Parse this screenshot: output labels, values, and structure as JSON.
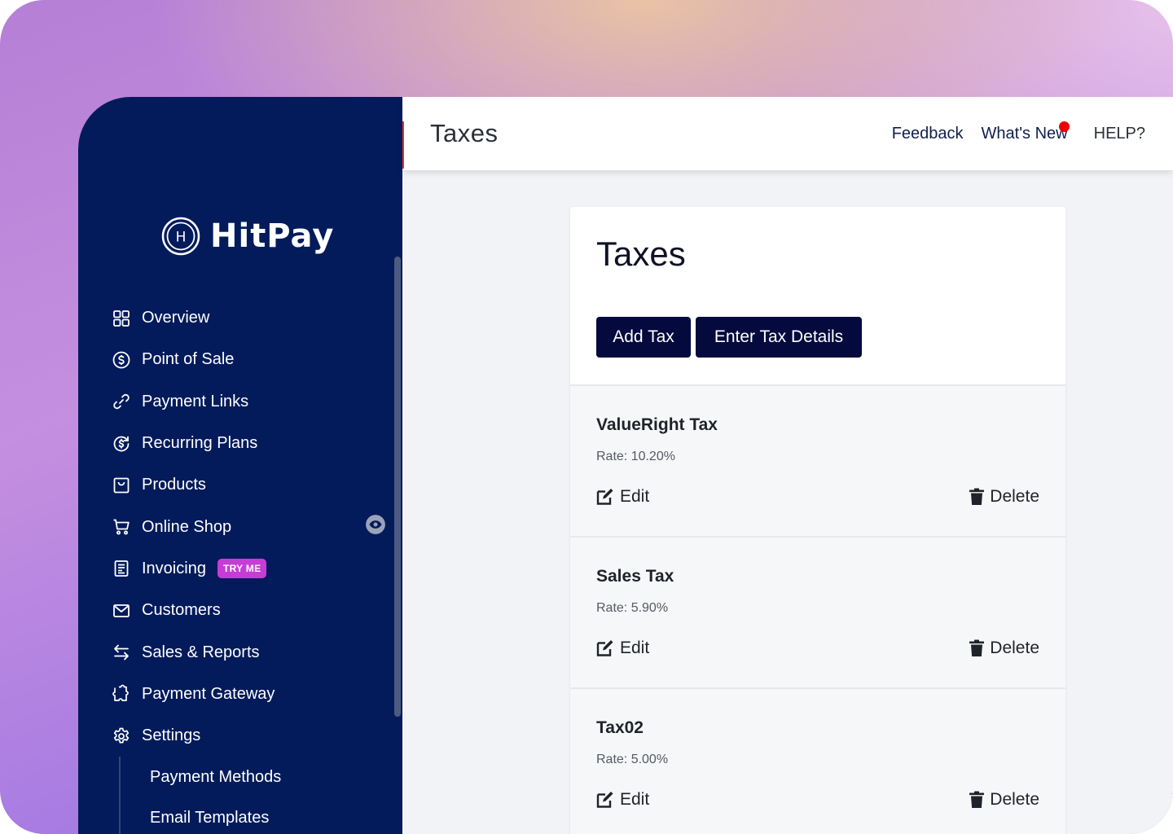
{
  "brand": {
    "name": "HitPay",
    "logo_letter": "H"
  },
  "sidebar": {
    "items": [
      {
        "label": "Overview",
        "icon": "grid-icon"
      },
      {
        "label": "Point of Sale",
        "icon": "dollar-circle-icon"
      },
      {
        "label": "Payment Links",
        "icon": "link-icon"
      },
      {
        "label": "Recurring Plans",
        "icon": "recurring-dollar-icon"
      },
      {
        "label": "Products",
        "icon": "bag-icon"
      },
      {
        "label": "Online Shop",
        "icon": "cart-icon"
      },
      {
        "label": "Invoicing",
        "icon": "invoice-icon",
        "badge": "TRY ME"
      },
      {
        "label": "Customers",
        "icon": "mail-icon"
      },
      {
        "label": "Sales & Reports",
        "icon": "swap-arrows-icon"
      },
      {
        "label": "Payment Gateway",
        "icon": "puzzle-icon"
      },
      {
        "label": "Settings",
        "icon": "gear-icon"
      }
    ],
    "sub_items": [
      {
        "label": "Payment Methods"
      },
      {
        "label": "Email Templates"
      }
    ]
  },
  "header": {
    "title": "Taxes",
    "links": {
      "feedback": "Feedback",
      "whats_new": "What's New",
      "help": "HELP?"
    }
  },
  "main": {
    "title": "Taxes",
    "buttons": {
      "add_tax": "Add Tax",
      "enter_details": "Enter Tax Details"
    },
    "taxes": [
      {
        "name": "ValueRight Tax",
        "rate": "Rate: 10.20%",
        "edit": "Edit",
        "delete": "Delete"
      },
      {
        "name": "Sales Tax",
        "rate": "Rate: 5.90%",
        "edit": "Edit",
        "delete": "Delete"
      },
      {
        "name": "Tax02",
        "rate": "Rate: 5.00%",
        "edit": "Edit",
        "delete": "Delete"
      }
    ]
  },
  "colors": {
    "sidebar_bg": "#031b5b",
    "button_bg": "#050a3e",
    "badge_bg": "#c73cd6",
    "notification_dot": "#f00000"
  }
}
